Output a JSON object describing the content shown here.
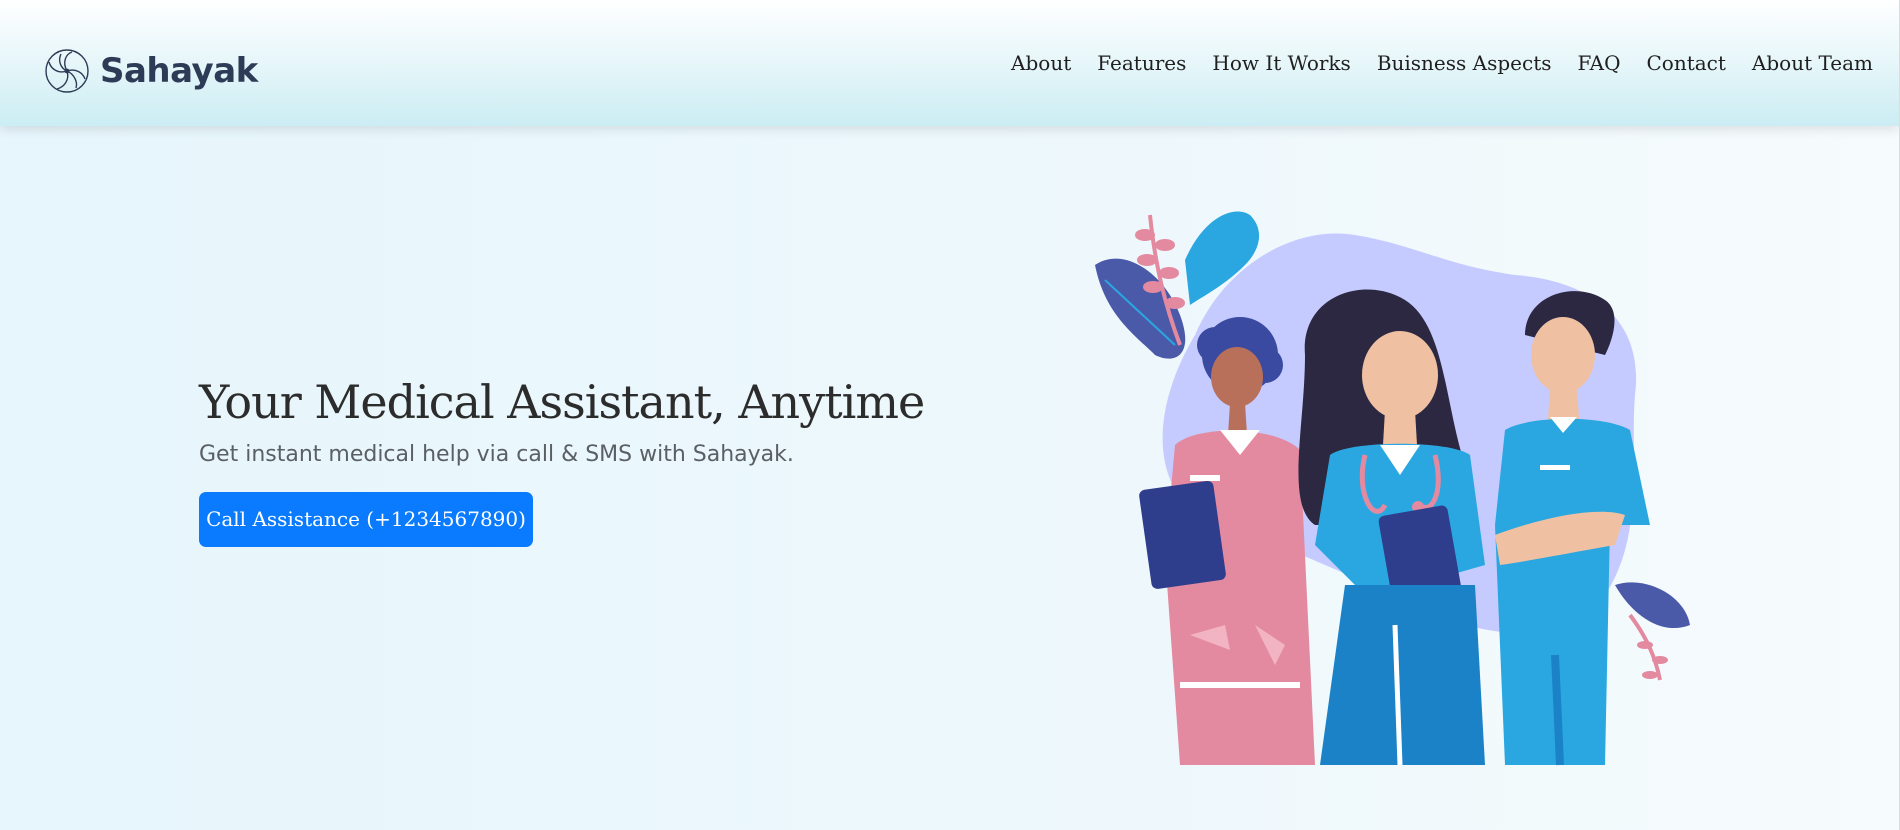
{
  "brand": {
    "name": "Sahayak",
    "logo_icon": "flower-logo-icon"
  },
  "nav": {
    "items": [
      {
        "label": "About"
      },
      {
        "label": "Features"
      },
      {
        "label": "How It Works"
      },
      {
        "label": "Buisness Aspects"
      },
      {
        "label": "FAQ"
      },
      {
        "label": "Contact"
      },
      {
        "label": "About Team"
      }
    ]
  },
  "hero": {
    "title": "Your Medical Assistant, Anytime",
    "subtitle": "Get instant medical help via call & SMS with Sahayak.",
    "cta_label": "Call Assistance (+1234567890)",
    "illustration_icon": "medical-staff-illustration"
  },
  "colors": {
    "accent": "#0a7bff",
    "brand_text": "#2e3b56",
    "nav_gradient_bottom": "#cbedf3",
    "blob": "#c5cbff",
    "scrub_blue": "#2aa7e0",
    "scrub_pink": "#e48aa0",
    "hair_dark": "#2c2841"
  }
}
